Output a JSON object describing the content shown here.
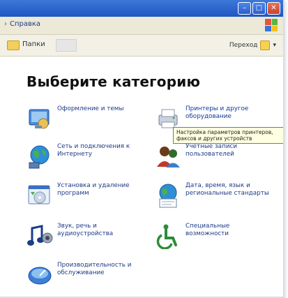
{
  "window": {
    "min_glyph": "–",
    "max_glyph": "□",
    "close_glyph": "✕"
  },
  "menu": {
    "item": "Справка"
  },
  "toolbar": {
    "folders_label": "Папки",
    "right_label": "Переход"
  },
  "main": {
    "heading": "Выберите категорию",
    "categories": [
      {
        "label": "Оформление и темы"
      },
      {
        "label": "Принтеры и другое оборудование"
      },
      {
        "label": "Сеть и подключения к Интернету"
      },
      {
        "label": "Учетные записи пользователей"
      },
      {
        "label": "Установка и удаление программ"
      },
      {
        "label": "Дата, время, язык и региональные стандарты"
      },
      {
        "label": "Звук, речь и аудиоустройства"
      },
      {
        "label": "Специальные возможности"
      },
      {
        "label": "Производительность и обслуживание"
      }
    ],
    "tooltip": "Настройка параметров принтеров, факсов и других устройств"
  },
  "colors": {
    "accent": "#245edb",
    "link": "#1e3a86",
    "tooltip_bg": "#ffffe1"
  }
}
